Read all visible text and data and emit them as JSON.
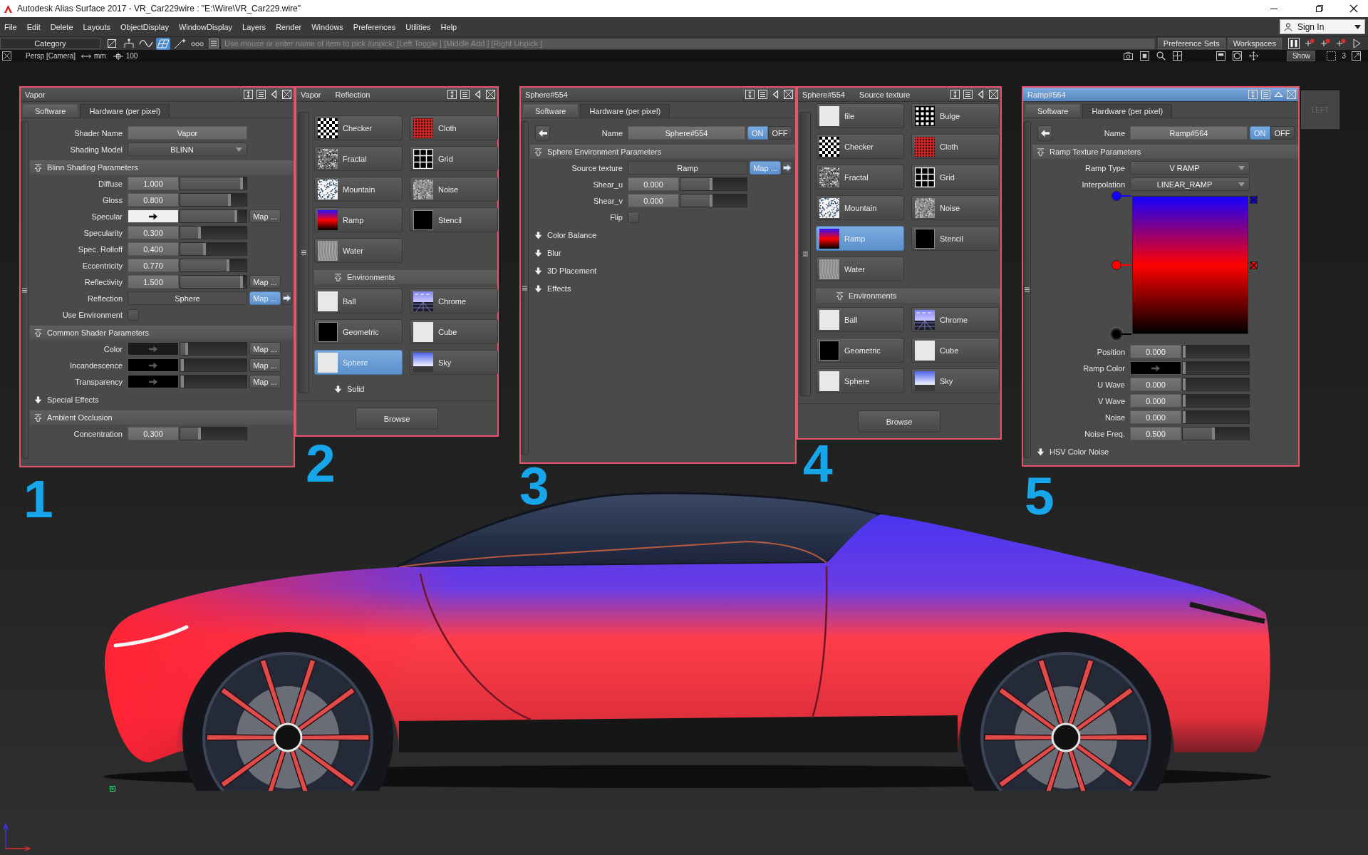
{
  "window": {
    "title": "Autodesk Alias Surface 2017  - VR_Car229wire : \"E:\\Wire\\VR_Car229.wire\""
  },
  "menu": [
    "File",
    "Edit",
    "Delete",
    "Layouts",
    "ObjectDisplay",
    "WindowDisplay",
    "Layers",
    "Render",
    "Windows",
    "Preferences",
    "Utilities",
    "Help"
  ],
  "account": {
    "label": "Sign In"
  },
  "toolbar": {
    "category": "Category",
    "tools": [
      {
        "kind": "frame",
        "selected": false
      },
      {
        "kind": "tree",
        "selected": false
      },
      {
        "kind": "wave",
        "selected": false
      },
      {
        "kind": "surface",
        "selected": true
      },
      {
        "kind": "sparkle",
        "selected": false
      },
      {
        "kind": "dots",
        "selected": false
      }
    ],
    "prompt": {
      "placeholder": "Use mouse or enter name of item to pick /unpick: [Left Toggle ] [Middle Add ] [Right Unpick ]"
    },
    "preference_sets": "Preference Sets",
    "workspaces": "Workspaces"
  },
  "status_bar": {
    "camera": "Persp [Camera]",
    "units": "mm",
    "scale": "100",
    "show": "Show",
    "layout": "3"
  },
  "panels": [
    {
      "kind": "editor",
      "title": "Vapor",
      "active": false,
      "tabs": [
        {
          "label": "Software",
          "selected": true
        },
        {
          "label": "Hardware (per pixel)",
          "selected": false
        }
      ],
      "rows": [
        {
          "kind": "text",
          "label": "Shader Name",
          "value": "Vapor"
        },
        {
          "kind": "dropdown",
          "label": "Shading Model",
          "value": "BLINN"
        }
      ],
      "sections": [
        {
          "title": "Blinn Shading Parameters",
          "expanded": true,
          "rows": [
            {
              "kind": "slider",
              "label": "Diffuse",
              "value": "1.000",
              "level": 0.95
            },
            {
              "kind": "slider",
              "label": "Gloss",
              "value": "0.800",
              "level": 0.76
            },
            {
              "kind": "color",
              "label": "Specular",
              "color": "#efefef",
              "level": 0.86,
              "map": {
                "label": "Map ...",
                "selected": false
              }
            },
            {
              "kind": "slider",
              "label": "Specularity",
              "value": "0.300",
              "level": 0.31
            },
            {
              "kind": "slider",
              "label": "Spec. Rolloff",
              "value": "0.400",
              "level": 0.39
            },
            {
              "kind": "slider",
              "label": "Eccentricity",
              "value": "0.770",
              "level": 0.74
            },
            {
              "kind": "slider",
              "label": "Reflectivity",
              "value": "1.500",
              "level": 0.95,
              "map": {
                "label": "Map ...",
                "selected": false
              }
            },
            {
              "kind": "link",
              "label": "Reflection",
              "value": "Sphere",
              "map": {
                "label": "Map ...",
                "selected": true
              }
            },
            {
              "kind": "checkbox",
              "label": "Use Environment",
              "checked": false
            }
          ]
        },
        {
          "title": "Common Shader Parameters",
          "expanded": true,
          "rows": [
            {
              "kind": "color",
              "label": "Color",
              "color": "#1b1b1b",
              "level": 0.12,
              "map": {
                "label": "Map ...",
                "selected": false
              }
            },
            {
              "kind": "color",
              "label": "Incandescence",
              "color": "#000000",
              "level": 0.05,
              "map": {
                "label": "Map ...",
                "selected": false
              }
            },
            {
              "kind": "color",
              "label": "Transparency",
              "color": "#000000",
              "level": 0.05,
              "map": {
                "label": "Map ...",
                "selected": false
              }
            }
          ]
        },
        {
          "title": "Special Effects",
          "expanded": false
        },
        {
          "title": "Ambient Occlusion",
          "expanded": true,
          "rows": [
            {
              "kind": "slider",
              "label": "Concentration",
              "value": "0.300",
              "level": 0.31
            }
          ]
        }
      ]
    },
    {
      "kind": "browser",
      "title": "Vapor",
      "subtitle": "Reflection",
      "active": false,
      "textures": [
        {
          "label": "Checker",
          "kind": "checker",
          "selected": false
        },
        {
          "label": "Cloth",
          "kind": "cloth",
          "selected": false
        },
        {
          "label": "Fractal",
          "kind": "fractal",
          "selected": false
        },
        {
          "label": "Grid",
          "kind": "grid",
          "selected": false
        },
        {
          "label": "Mountain",
          "kind": "mountain",
          "selected": false
        },
        {
          "label": "Noise",
          "kind": "noise",
          "selected": false
        },
        {
          "label": "Ramp",
          "kind": "ramp",
          "selected": false
        },
        {
          "label": "Stencil",
          "kind": "stencil",
          "selected": false
        },
        {
          "label": "Water",
          "kind": "water",
          "selected": false
        }
      ],
      "sections": [
        {
          "title": "Environments",
          "expanded": true,
          "items": [
            {
              "label": "Ball",
              "kind": "ball",
              "selected": false
            },
            {
              "label": "Chrome",
              "kind": "chrome",
              "selected": false
            },
            {
              "label": "Geometric",
              "kind": "geometric",
              "selected": false
            },
            {
              "label": "Cube",
              "kind": "cube",
              "selected": false
            },
            {
              "label": "Sphere",
              "kind": "sphere",
              "selected": true
            },
            {
              "label": "Sky",
              "kind": "sky",
              "selected": false
            }
          ]
        },
        {
          "title": "Solid",
          "expanded": false
        }
      ],
      "button": "Browse"
    },
    {
      "kind": "editor",
      "title": "Sphere#554",
      "active": false,
      "tabs": [
        {
          "label": "Software",
          "selected": true
        },
        {
          "label": "Hardware (per pixel)",
          "selected": false
        }
      ],
      "name_row": {
        "label": "Name",
        "value": "Sphere#554",
        "toggle": [
          {
            "label": "ON",
            "selected": true
          },
          {
            "label": "OFF",
            "selected": false
          }
        ]
      },
      "sections": [
        {
          "title": "Sphere Environment Parameters",
          "expanded": true,
          "rows": [
            {
              "kind": "link",
              "label": "Source texture",
              "value": "Ramp",
              "map": {
                "label": "Map ...",
                "selected": true
              }
            },
            {
              "kind": "slider",
              "label": "Shear_u",
              "value": "0.000",
              "level": 0.48
            },
            {
              "kind": "slider",
              "label": "Shear_v",
              "value": "0.000",
              "level": 0.48
            },
            {
              "kind": "checkbox",
              "label": "Flip",
              "checked": false
            }
          ]
        },
        {
          "title": "Color Balance",
          "expanded": false
        },
        {
          "title": "Blur",
          "expanded": false
        },
        {
          "title": "3D Placement",
          "expanded": false
        },
        {
          "title": "Effects",
          "expanded": false
        }
      ]
    },
    {
      "kind": "browser",
      "title": "Sphere#554",
      "subtitle": "Source texture",
      "active": false,
      "textures": [
        {
          "label": "file",
          "kind": "file",
          "selected": false
        },
        {
          "label": "Bulge",
          "kind": "bulge",
          "selected": false
        },
        {
          "label": "Checker",
          "kind": "checker",
          "selected": false
        },
        {
          "label": "Cloth",
          "kind": "cloth",
          "selected": false
        },
        {
          "label": "Fractal",
          "kind": "fractal",
          "selected": false
        },
        {
          "label": "Grid",
          "kind": "grid",
          "selected": false
        },
        {
          "label": "Mountain",
          "kind": "mountain",
          "selected": false
        },
        {
          "label": "Noise",
          "kind": "noise",
          "selected": false
        },
        {
          "label": "Ramp",
          "kind": "ramp",
          "selected": true
        },
        {
          "label": "Stencil",
          "kind": "stencil",
          "selected": false
        },
        {
          "label": "Water",
          "kind": "water",
          "selected": false
        }
      ],
      "sections": [
        {
          "title": "Environments",
          "expanded": true,
          "items": [
            {
              "label": "Ball",
              "kind": "ball",
              "selected": false
            },
            {
              "label": "Chrome",
              "kind": "chrome",
              "selected": false
            },
            {
              "label": "Geometric",
              "kind": "geometric",
              "selected": false
            },
            {
              "label": "Cube",
              "kind": "cube",
              "selected": false
            },
            {
              "label": "Sphere",
              "kind": "sphere",
              "selected": false
            },
            {
              "label": "Sky",
              "kind": "sky",
              "selected": false
            }
          ]
        }
      ],
      "button": "Browse"
    },
    {
      "kind": "editor",
      "title": "Ramp#564",
      "active": true,
      "tabs": [
        {
          "label": "Software",
          "selected": true
        },
        {
          "label": "Hardware (per pixel)",
          "selected": false
        }
      ],
      "name_row": {
        "label": "Name",
        "value": "Ramp#564",
        "toggle": [
          {
            "label": "ON",
            "selected": true
          },
          {
            "label": "OFF",
            "selected": false
          }
        ]
      },
      "sections": [
        {
          "title": "Ramp Texture Parameters",
          "expanded": true,
          "rows": [
            {
              "kind": "dropdown",
              "label": "Ramp Type",
              "value": "V RAMP"
            },
            {
              "kind": "dropdown",
              "label": "Interpolation",
              "value": "LINEAR_RAMP"
            },
            {
              "kind": "ramp",
              "stops": [
                {
                  "color": "#1400ff",
                  "selected": false
                },
                {
                  "color": "#ff0000",
                  "selected": false
                },
                {
                  "color": "#000000",
                  "selected": true
                }
              ]
            },
            {
              "kind": "slider",
              "label": "Position",
              "value": "0.000",
              "level": 0.04
            },
            {
              "kind": "color",
              "label": "Ramp Color",
              "color": "#000000",
              "level": 0.04
            },
            {
              "kind": "slider",
              "label": "U Wave",
              "value": "0.000",
              "level": 0.04
            },
            {
              "kind": "slider",
              "label": "V Wave",
              "value": "0.000",
              "level": 0.04
            },
            {
              "kind": "slider",
              "label": "Noise",
              "value": "0.000",
              "level": 0.04
            },
            {
              "kind": "slider",
              "label": "Noise Freq.",
              "value": "0.500",
              "level": 0.48
            }
          ]
        },
        {
          "title": "HSV Color Noise",
          "expanded": false
        }
      ]
    }
  ],
  "view_cube": {
    "label": "LEFT"
  },
  "annotations": [
    "1",
    "2",
    "3",
    "4",
    "5"
  ]
}
